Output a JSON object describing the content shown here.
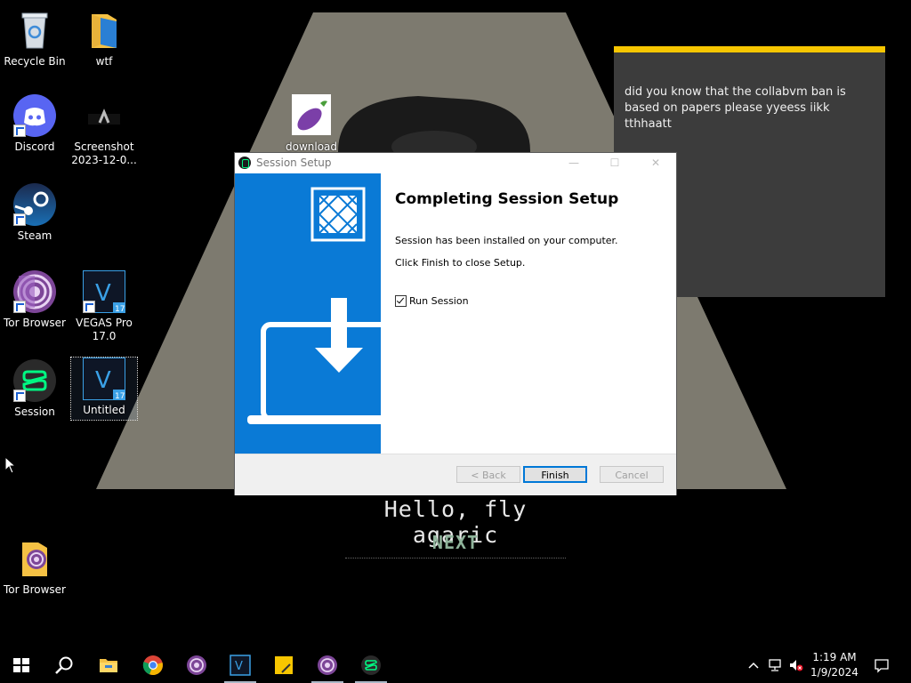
{
  "desktop": {
    "icons": [
      {
        "label": "Recycle Bin",
        "icon": "recycle-bin-icon"
      },
      {
        "label": "wtf",
        "icon": "folder-icon"
      },
      {
        "label": "Discord",
        "icon": "discord-icon"
      },
      {
        "label": "Screenshot\n2023-12-0...",
        "icon": "screenshot-file-icon"
      },
      {
        "label": "Steam",
        "icon": "steam-icon"
      },
      {
        "label": "Tor Browser",
        "icon": "tor-browser-icon"
      },
      {
        "label": "VEGAS Pro\n17.0",
        "icon": "vegas-pro-icon"
      },
      {
        "label": "Session",
        "icon": "session-icon"
      },
      {
        "label": "Untitled",
        "icon": "vegas-pro-icon"
      },
      {
        "label": "download",
        "icon": "eggplant-image-icon"
      },
      {
        "label": "Tor Browser",
        "icon": "tor-folder-icon"
      }
    ]
  },
  "wallpaper": {
    "caption": "Hello, fly agaric",
    "next": "NEXT"
  },
  "sticky_note": {
    "text": "did you know that the collabvm ban is based on papers please  yyeess  iikk  tthhaatt",
    "accent": "#f7c600"
  },
  "installer": {
    "title": "Session Setup",
    "heading": "Completing Session Setup",
    "line1": "Session has been installed on your computer.",
    "line2": "Click Finish to close Setup.",
    "run_label": "Run Session",
    "run_checked": true,
    "buttons": {
      "back": "< Back",
      "finish": "Finish",
      "cancel": "Cancel"
    },
    "titlebar": {
      "minimize": "—",
      "maximize": "☐",
      "close": "✕"
    },
    "accent": "#0a7ad6"
  },
  "taskbar": {
    "apps": [
      "start-icon",
      "search-icon",
      "file-explorer-icon",
      "chrome-icon",
      "tor-browser-icon",
      "vegas-pro-icon",
      "sticky-notes-icon",
      "tor-browser-icon",
      "session-icon"
    ],
    "clock_time": "1:19 AM",
    "clock_date": "1/9/2024"
  }
}
